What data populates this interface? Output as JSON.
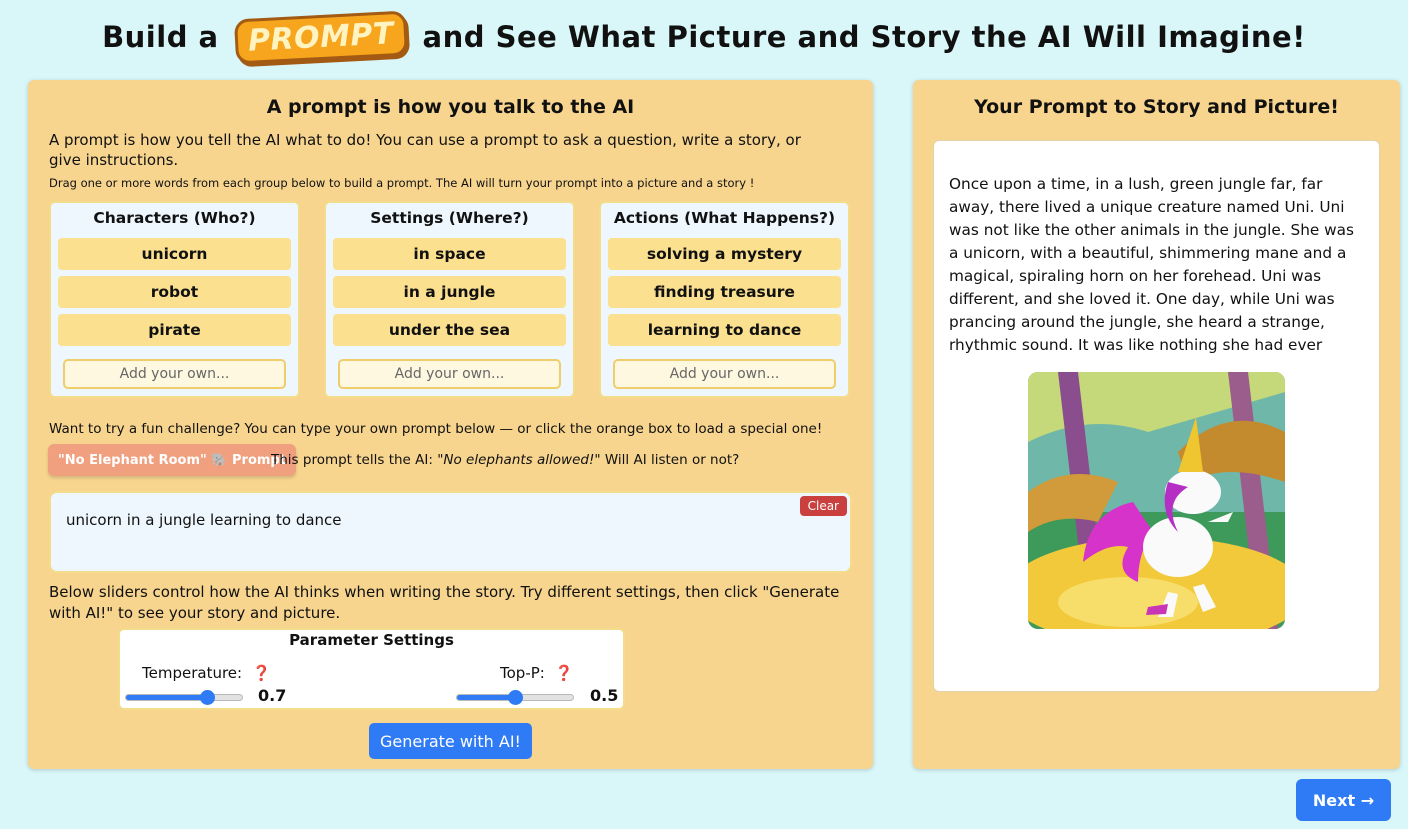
{
  "header": {
    "title_before": "Build a",
    "logo_text": "PROMPT",
    "title_after": "and See What Picture and Story the AI Will Imagine!"
  },
  "left_panel": {
    "title": "A prompt is how you talk to the AI",
    "intro": "A prompt is how you tell the AI what to do! You can use a prompt to ask a question, write a story, or give instructions.",
    "hint": "Drag one or more words from each group below to build a prompt. The AI will turn your prompt into a picture and a story !",
    "groups": [
      {
        "title": "Characters (Who?)",
        "items": [
          "unicorn",
          "robot",
          "pirate"
        ],
        "placeholder": "Add your own..."
      },
      {
        "title": "Settings (Where?)",
        "items": [
          "in space",
          "in a jungle",
          "under the sea"
        ],
        "placeholder": "Add your own..."
      },
      {
        "title": "Actions (What Happens?)",
        "items": [
          "solving a mystery",
          "finding treasure",
          "learning to dance"
        ],
        "placeholder": "Add your own..."
      }
    ],
    "challenge_text": "Want to try a fun challenge? You can type your own prompt below — or click the orange box to load a special one!",
    "special_button": "\"No Elephant Room\" 🐘 Prompt",
    "special_desc_prefix": "This prompt tells the AI:",
    "special_desc_quote": "\"No elephants allowed!\"",
    "special_desc_suffix": "Will AI listen or not?",
    "prompt_value": "unicorn in a jungle learning to dance",
    "clear_label": "Clear",
    "slider_help": "Below sliders control how the AI thinks when writing the story. Try different settings, then click \"Generate with AI!\" to see your story and picture.",
    "params": {
      "title": "Parameter Settings",
      "temperature_label": "Temperature:",
      "temperature_value": "0.7",
      "top_p_label": "Top-P:",
      "top_p_value": "0.5",
      "help_mark": "❓"
    },
    "generate_label": "Generate with AI!"
  },
  "right_panel": {
    "title": "Your Prompt to Story and Picture!",
    "story": "Once upon a time, in a lush, green jungle far, far away, there lived a unique creature named Uni. Uni was not like the other animals in the jungle. She was a unicorn, with a beautiful, shimmering mane and a magical, spiraling horn on her forehead. Uni was different, and she loved it. One day, while Uni was prancing around the jungle, she heard a strange, rhythmic sound. It was like nothing she had ever heard before. She followed"
  },
  "next_label": "Next →",
  "colors": {
    "background": "#d9f6f8",
    "panel": "#f7d58f",
    "chip": "#fbe08f",
    "accent_blue": "#2f7bf6",
    "special_orange": "#f0a07e",
    "clear_red": "#c9403e"
  }
}
